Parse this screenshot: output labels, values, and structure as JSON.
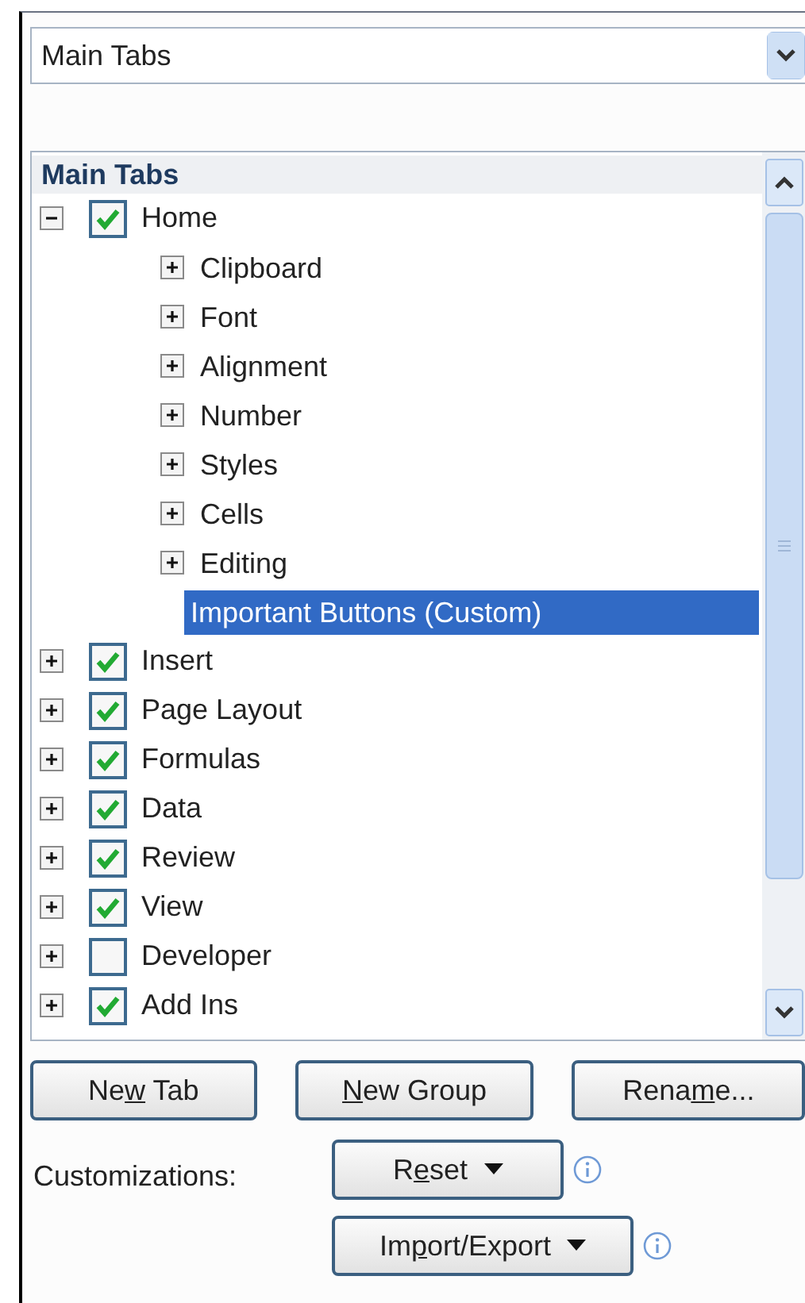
{
  "scope_dropdown": {
    "value": "Main Tabs"
  },
  "tree": {
    "header": "Main Tabs",
    "items": [
      {
        "label": "Home",
        "checked": true,
        "expanded": true,
        "selected": false,
        "children": [
          {
            "label": "Clipboard",
            "kind": "group",
            "expanded": false,
            "selected": false
          },
          {
            "label": "Font",
            "kind": "group",
            "expanded": false,
            "selected": false
          },
          {
            "label": "Alignment",
            "kind": "group",
            "expanded": false,
            "selected": false
          },
          {
            "label": "Number",
            "kind": "group",
            "expanded": false,
            "selected": false
          },
          {
            "label": "Styles",
            "kind": "group",
            "expanded": false,
            "selected": false
          },
          {
            "label": "Cells",
            "kind": "group",
            "expanded": false,
            "selected": false
          },
          {
            "label": "Editing",
            "kind": "group",
            "expanded": false,
            "selected": false
          },
          {
            "label": "Important Buttons (Custom)",
            "kind": "custom",
            "selected": true
          }
        ]
      },
      {
        "label": "Insert",
        "checked": true,
        "expanded": false,
        "selected": false
      },
      {
        "label": "Page Layout",
        "checked": true,
        "expanded": false,
        "selected": false
      },
      {
        "label": "Formulas",
        "checked": true,
        "expanded": false,
        "selected": false
      },
      {
        "label": "Data",
        "checked": true,
        "expanded": false,
        "selected": false
      },
      {
        "label": "Review",
        "checked": true,
        "expanded": false,
        "selected": false
      },
      {
        "label": "View",
        "checked": true,
        "expanded": false,
        "selected": false
      },
      {
        "label": "Developer",
        "checked": false,
        "expanded": false,
        "selected": false
      },
      {
        "label": "Add Ins",
        "checked": true,
        "expanded": false,
        "selected": false
      }
    ]
  },
  "tree_buttons": [
    {
      "before": "Ne",
      "key": "w",
      "after": " Tab"
    },
    {
      "key": "N",
      "after": "ew Group"
    },
    {
      "before": "Rena",
      "key": "m",
      "after": "e..."
    }
  ],
  "customizations": {
    "label": "Customizations:",
    "buttons": [
      {
        "before": "R",
        "key": "e",
        "after": "set"
      },
      {
        "before": "Im",
        "key": "p",
        "after": "ort/Export"
      }
    ]
  }
}
